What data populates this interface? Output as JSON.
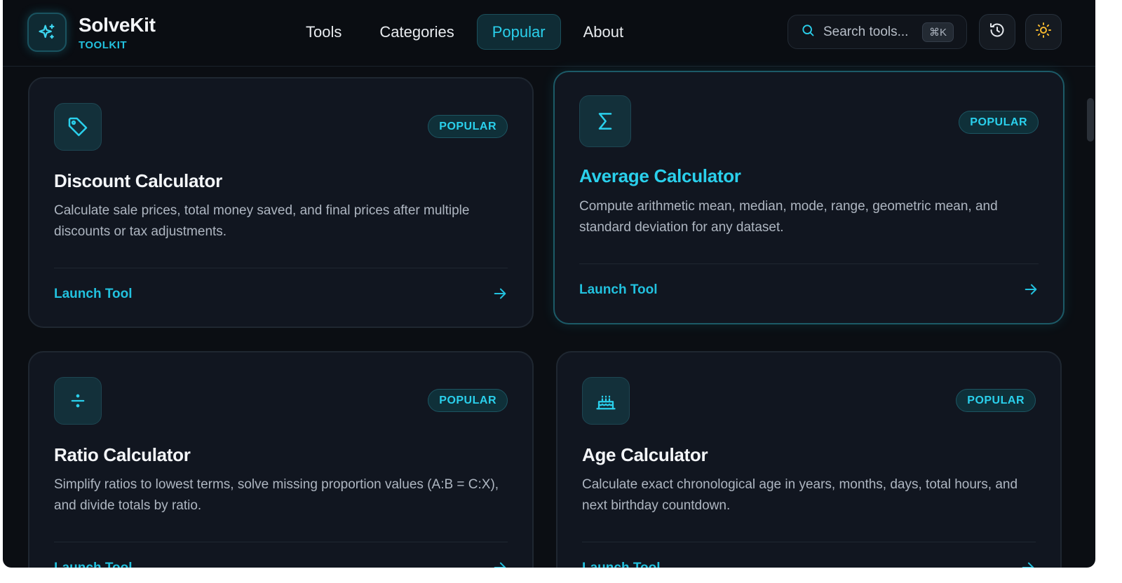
{
  "brand": {
    "name": "SolveKit",
    "subtitle": "TOOLKIT"
  },
  "nav": [
    {
      "label": "Tools",
      "active": false
    },
    {
      "label": "Categories",
      "active": false
    },
    {
      "label": "Popular",
      "active": true
    },
    {
      "label": "About",
      "active": false
    }
  ],
  "search": {
    "placeholder": "Search tools...",
    "shortcut": "⌘K"
  },
  "colors": {
    "accent": "#22c1de",
    "background": "#0b0e13",
    "card": "#111620"
  },
  "cards": [
    {
      "icon": "tag-icon",
      "badge": "POPULAR",
      "title": "Discount Calculator",
      "description": "Calculate sale prices, total money saved, and final prices after multiple discounts or tax adjustments.",
      "cta": "Launch Tool"
    },
    {
      "icon": "sigma-icon",
      "badge": "POPULAR",
      "title": "Average Calculator",
      "description": "Compute arithmetic mean, median, mode, range, geometric mean, and standard deviation for any dataset.",
      "cta": "Launch Tool"
    },
    {
      "icon": "divide-icon",
      "badge": "POPULAR",
      "title": "Ratio Calculator",
      "description": "Simplify ratios to lowest terms, solve missing proportion values (A:B = C:X), and divide totals by ratio.",
      "cta": "Launch Tool"
    },
    {
      "icon": "cake-icon",
      "badge": "POPULAR",
      "title": "Age Calculator",
      "description": "Calculate exact chronological age in years, months, days, total hours, and next birthday countdown.",
      "cta": "Launch Tool"
    }
  ]
}
